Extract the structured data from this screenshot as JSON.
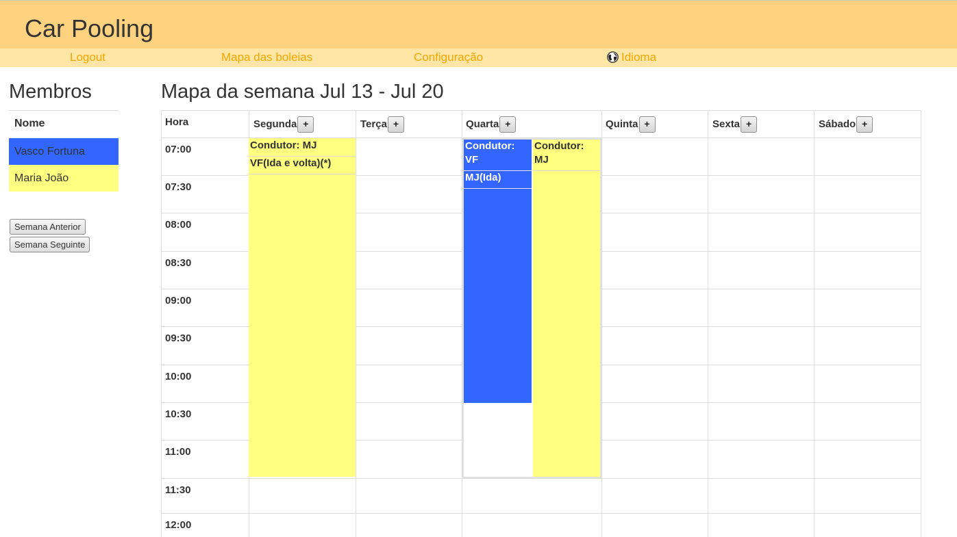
{
  "app": {
    "title": "Car Pooling"
  },
  "nav": [
    {
      "label": "Logout",
      "icon": null
    },
    {
      "label": "Mapa das boleias",
      "icon": null
    },
    {
      "label": "Configuração",
      "icon": null
    },
    {
      "label": "Idioma",
      "icon": "globe-icon"
    }
  ],
  "sidebar": {
    "title": "Membros",
    "column_header": "Nome",
    "members": [
      {
        "name": "Vasco Fortuna",
        "color": "#3366ff"
      },
      {
        "name": "Maria João",
        "color": "#ffff80"
      }
    ],
    "prev_week_label": "Semana Anterior",
    "next_week_label": "Semana Seguinte"
  },
  "schedule": {
    "title": "Mapa da semana Jul 13 - Jul 20",
    "hour_header": "Hora",
    "add_label": "+",
    "days": [
      "Segunda",
      "Terça",
      "Quarta",
      "Quinta",
      "Sexta",
      "Sábado"
    ],
    "times": [
      "07:00",
      "07:30",
      "08:00",
      "08:30",
      "09:00",
      "09:30",
      "10:00",
      "10:30",
      "11:00",
      "11:30",
      "12:00"
    ]
  },
  "rides": {
    "monday": {
      "driver": "Condutor: MJ",
      "passenger": "VF(Ida e volta)(*)",
      "color": "#ffff80",
      "start": "07:00",
      "end": "11:30"
    },
    "wednesday_vf": {
      "driver": "Condutor: VF",
      "passenger": "MJ(Ida)",
      "color": "#3366ff",
      "start": "07:00",
      "end": "10:30"
    },
    "wednesday_mj": {
      "driver": "Condutor: MJ",
      "color": "#ffff80",
      "start": "07:00",
      "end": "11:30"
    }
  }
}
